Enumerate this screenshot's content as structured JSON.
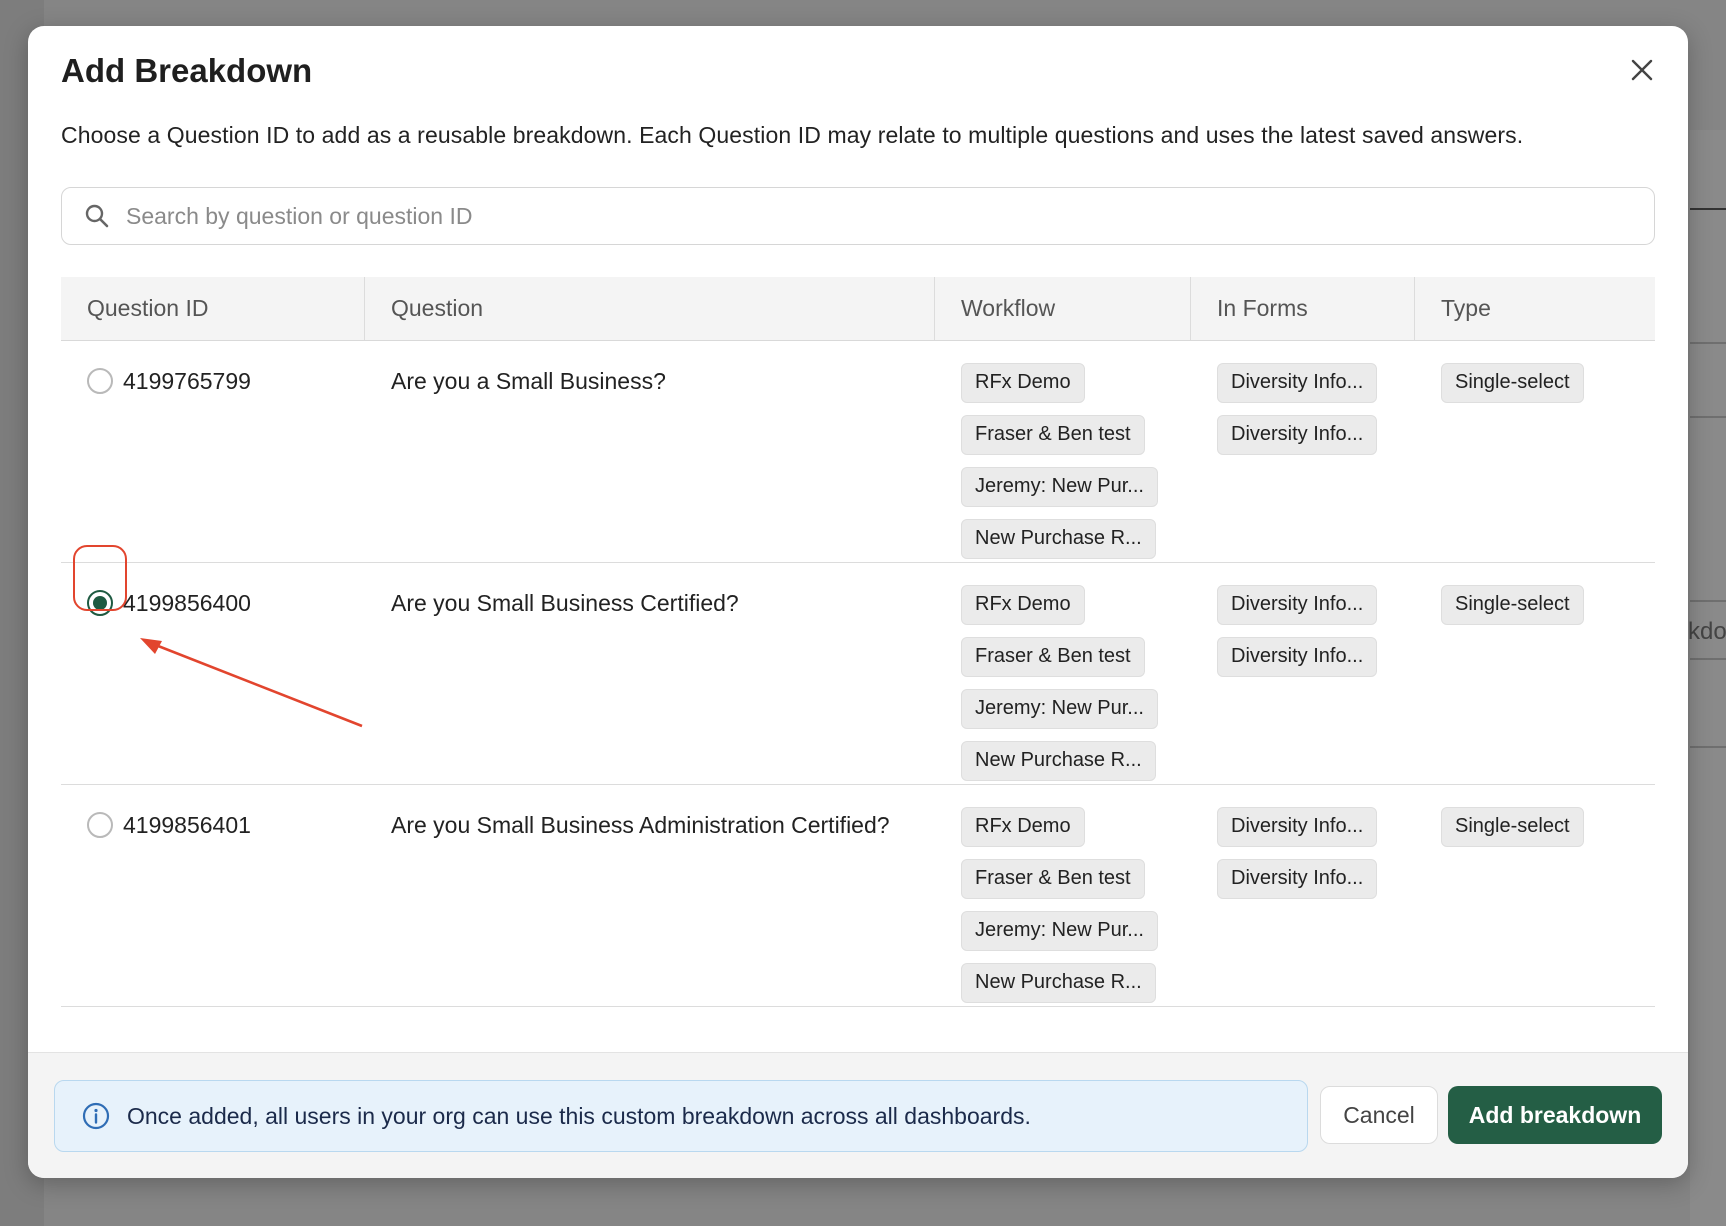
{
  "background": {
    "partial_text": "kdo"
  },
  "modal": {
    "title": "Add Breakdown",
    "close_icon": "close-icon",
    "description": "Choose a Question ID to add as a reusable breakdown. Each Question ID may relate to multiple questions and uses the latest saved answers.",
    "search": {
      "icon": "search-icon",
      "placeholder": "Search by question or question ID",
      "value": ""
    },
    "table": {
      "columns": [
        "Question ID",
        "Question",
        "Workflow",
        "In Forms",
        "Type"
      ],
      "rows": [
        {
          "selected": false,
          "question_id": "4199765799",
          "question": "Are you a Small Business?",
          "workflows": [
            "RFx Demo",
            "Fraser & Ben test",
            "Jeremy: New Pur...",
            "New Purchase R..."
          ],
          "forms": [
            "Diversity Info...",
            "Diversity Info..."
          ],
          "type": "Single-select"
        },
        {
          "selected": true,
          "question_id": "4199856400",
          "question": "Are you Small Business Certified?",
          "workflows": [
            "RFx Demo",
            "Fraser & Ben test",
            "Jeremy: New Pur...",
            "New Purchase R..."
          ],
          "forms": [
            "Diversity Info...",
            "Diversity Info..."
          ],
          "type": "Single-select"
        },
        {
          "selected": false,
          "question_id": "4199856401",
          "question": "Are you Small Business Administration Certified?",
          "workflows": [
            "RFx Demo",
            "Fraser & Ben test",
            "Jeremy: New Pur...",
            "New Purchase R..."
          ],
          "forms": [
            "Diversity Info...",
            "Diversity Info..."
          ],
          "type": "Single-select"
        }
      ]
    },
    "footer": {
      "info_icon": "info-icon",
      "info_text": "Once added, all users in your org can use this custom breakdown across all dashboards.",
      "cancel_label": "Cancel",
      "add_label": "Add breakdown"
    }
  },
  "colors": {
    "primary": "#245e45",
    "annotation": "#e2452e",
    "info_bg": "#e7f2fb"
  }
}
